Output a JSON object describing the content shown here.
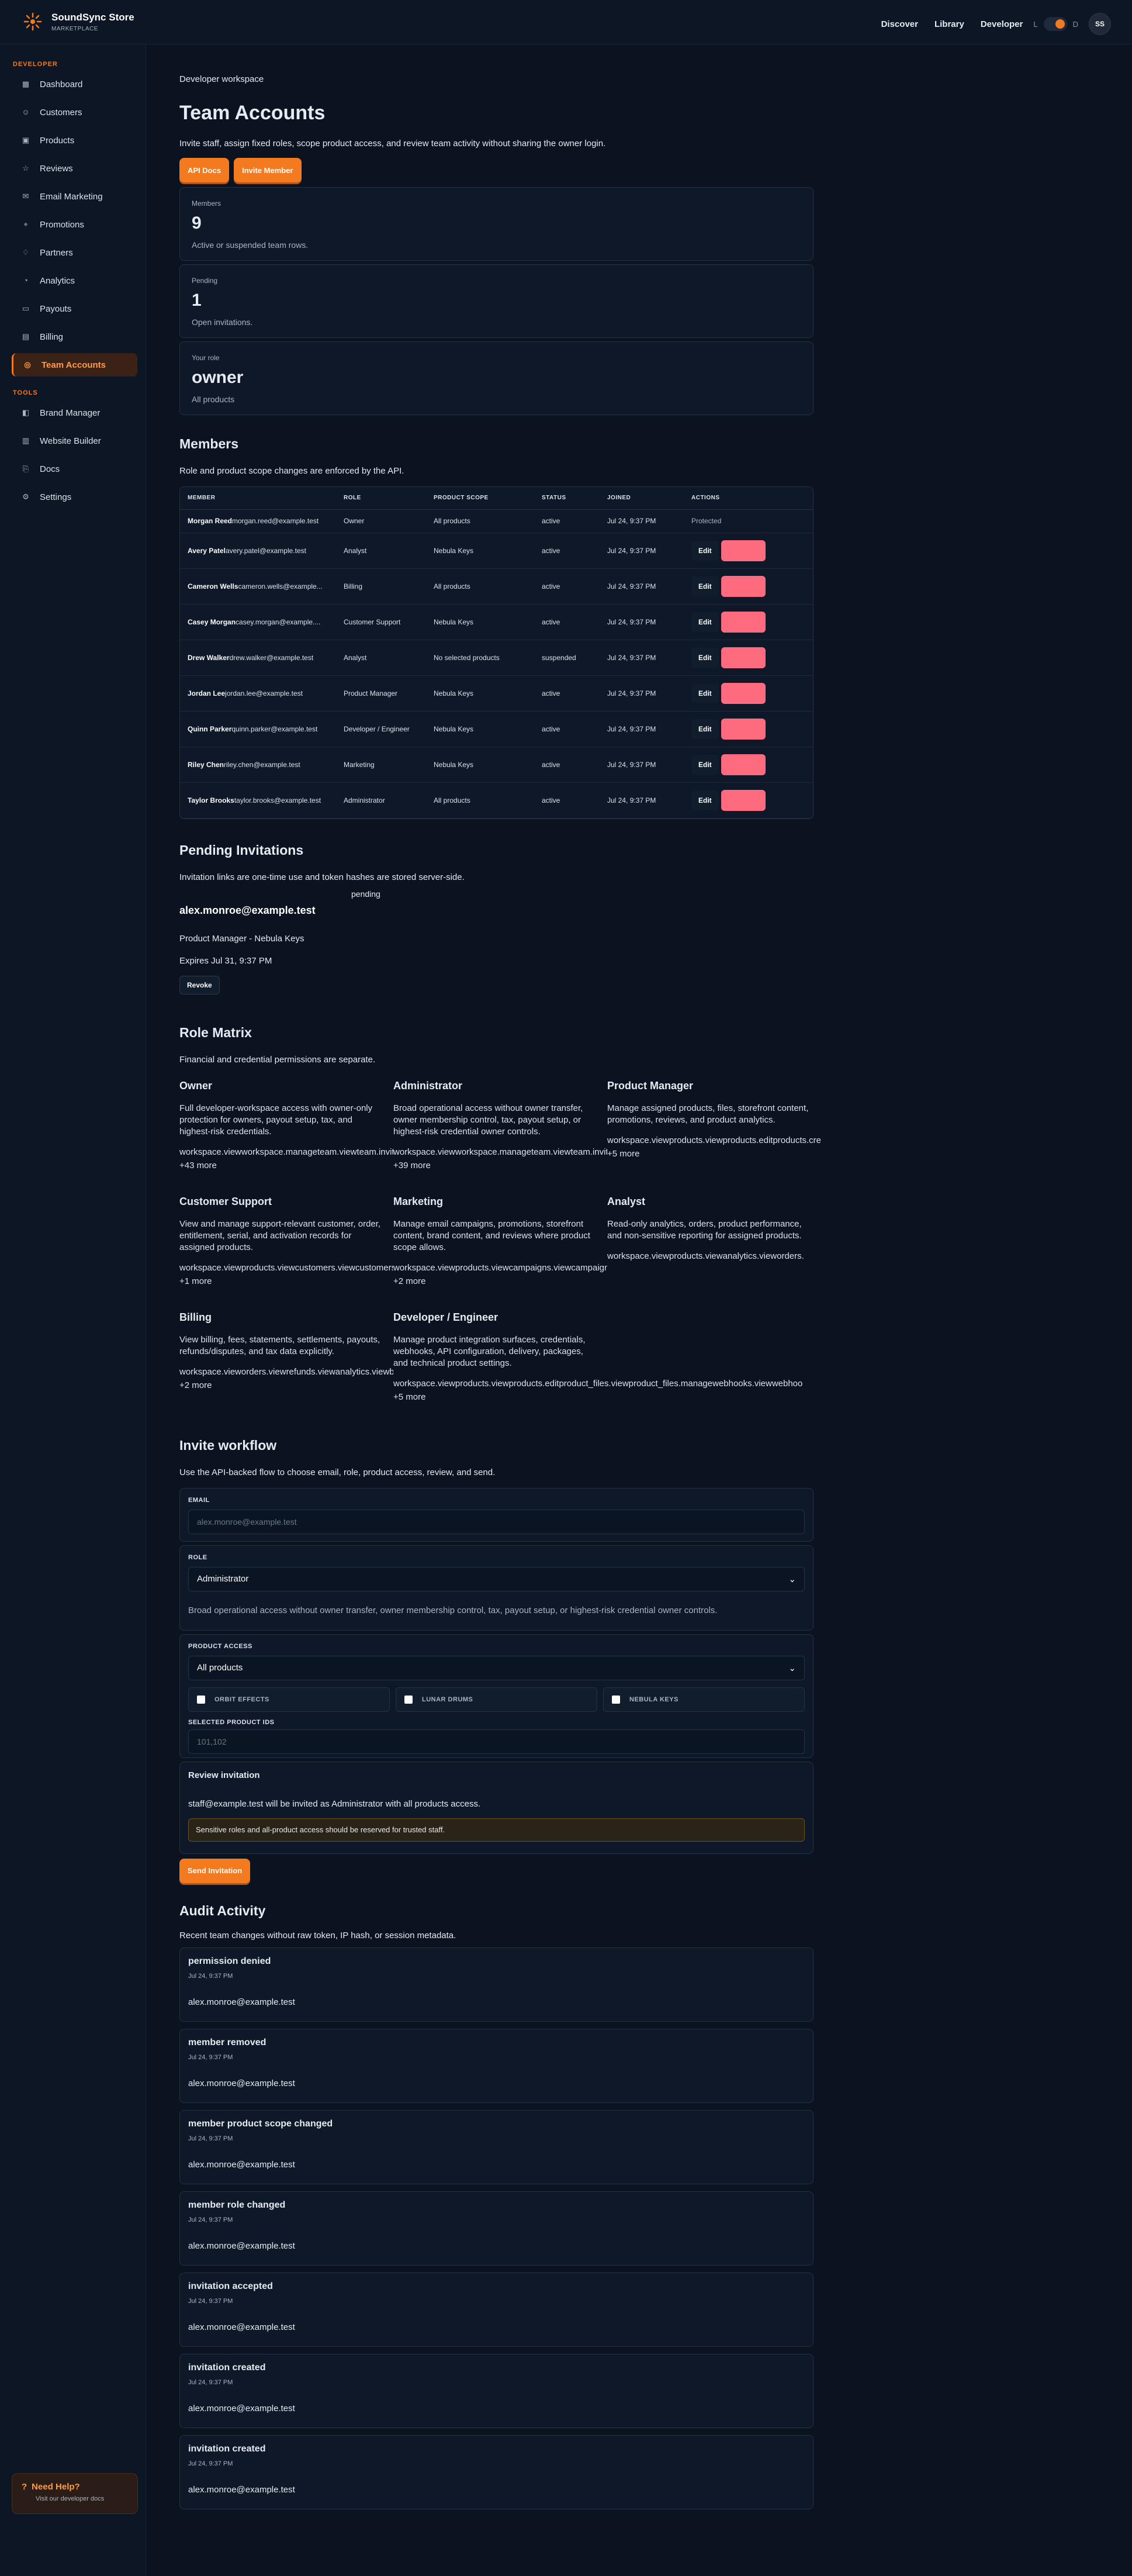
{
  "app": {
    "name": "SoundSync Store",
    "subtitle": "MARKETPLACE"
  },
  "topnav": {
    "discover": "Discover",
    "library": "Library",
    "developer": "Developer",
    "theme_light": "L",
    "theme_dark": "D",
    "avatar": "SS"
  },
  "sidebar": {
    "developer_section": "DEVELOPER",
    "items": [
      {
        "label": "Dashboard",
        "icon": "dashboard-icon"
      },
      {
        "label": "Customers",
        "icon": "users-icon"
      },
      {
        "label": "Products",
        "icon": "box-icon"
      },
      {
        "label": "Reviews",
        "icon": "star-icon"
      },
      {
        "label": "Email Marketing",
        "icon": "mail-icon"
      },
      {
        "label": "Promotions",
        "icon": "tag-icon"
      },
      {
        "label": "Partners",
        "icon": "partners-icon"
      },
      {
        "label": "Analytics",
        "icon": "chart-icon"
      },
      {
        "label": "Payouts",
        "icon": "wallet-icon"
      },
      {
        "label": "Billing",
        "icon": "receipt-icon"
      },
      {
        "label": "Team Accounts",
        "icon": "team-icon"
      }
    ],
    "tools_section": "TOOLS",
    "tools": [
      {
        "label": "Brand Manager",
        "icon": "brand-icon"
      },
      {
        "label": "Website Builder",
        "icon": "web-icon"
      },
      {
        "label": "Docs",
        "icon": "docs-icon"
      },
      {
        "label": "Settings",
        "icon": "gear-icon"
      }
    ],
    "help": {
      "title": "Need Help?",
      "desc": "Visit our developer docs"
    }
  },
  "page": {
    "eyebrow": "Developer workspace",
    "title": "Team Accounts",
    "lead": "Invite staff, assign fixed roles, scope product access, and review team activity without sharing the owner login.",
    "api_docs": "API Docs",
    "invite_member": "Invite Member"
  },
  "stats": [
    {
      "label": "Members",
      "value": "9",
      "desc": "Active or suspended team rows."
    },
    {
      "label": "Pending",
      "value": "1",
      "desc": "Open invitations."
    },
    {
      "label": "Your role",
      "value": "owner",
      "desc": "All products"
    }
  ],
  "members": {
    "title": "Members",
    "sub": "Role and product scope changes are enforced by the API.",
    "headers": [
      "MEMBER",
      "ROLE",
      "PRODUCT SCOPE",
      "STATUS",
      "JOINED",
      "ACTIONS"
    ],
    "edit_label": "Edit",
    "protected_label": "Protected",
    "rows": [
      {
        "name": "Morgan Reed",
        "email": "morgan.reed@example.test",
        "role": "Owner",
        "scope": "All products",
        "status": "active",
        "joined": "Jul 24, 9:37 PM"
      },
      {
        "name": "Avery Patel",
        "email": "avery.patel@example.test",
        "role": "Analyst",
        "scope": "Nebula Keys",
        "status": "active",
        "joined": "Jul 24, 9:37 PM"
      },
      {
        "name": "Cameron Wells",
        "email": "cameron.wells@example...",
        "role": "Billing",
        "scope": "All products",
        "status": "active",
        "joined": "Jul 24, 9:37 PM"
      },
      {
        "name": "Casey Morgan",
        "email": "casey.morgan@example....",
        "role": "Customer Support",
        "scope": "Nebula Keys",
        "status": "active",
        "joined": "Jul 24, 9:37 PM"
      },
      {
        "name": "Drew Walker",
        "email": "drew.walker@example.test",
        "role": "Analyst",
        "scope": "No selected products",
        "status": "suspended",
        "joined": "Jul 24, 9:37 PM"
      },
      {
        "name": "Jordan Lee",
        "email": "jordan.lee@example.test",
        "role": "Product Manager",
        "scope": "Nebula Keys",
        "status": "active",
        "joined": "Jul 24, 9:37 PM"
      },
      {
        "name": "Quinn Parker",
        "email": "quinn.parker@example.test",
        "role": "Developer / Engineer",
        "scope": "Nebula Keys",
        "status": "active",
        "joined": "Jul 24, 9:37 PM"
      },
      {
        "name": "Riley Chen",
        "email": "riley.chen@example.test",
        "role": "Marketing",
        "scope": "Nebula Keys",
        "status": "active",
        "joined": "Jul 24, 9:37 PM"
      },
      {
        "name": "Taylor Brooks",
        "email": "taylor.brooks@example.test",
        "role": "Administrator",
        "scope": "All products",
        "status": "active",
        "joined": "Jul 24, 9:37 PM"
      }
    ]
  },
  "pending": {
    "title": "Pending Invitations",
    "sub": "Invitation links are one-time use and token hashes are stored server-side.",
    "email": "alex.monroe@example.test",
    "status": "pending",
    "role_scope": "Product Manager - Nebula Keys",
    "expires": "Expires Jul 31, 9:37 PM",
    "revoke": "Revoke"
  },
  "matrix": {
    "title": "Role Matrix",
    "sub": "Financial and credential permissions are separate.",
    "roles": [
      {
        "name": "Owner",
        "desc": "Full developer-workspace access with owner-only protection for owners, payout setup, tax, and highest-risk credentials.",
        "perms": "workspace.viewworkspace.manageteam.viewteam.inviteteam.manage",
        "more": "+43 more"
      },
      {
        "name": "Administrator",
        "desc": "Broad operational access without owner transfer, owner membership control, tax, payout setup, or highest-risk credential owner controls.",
        "perms": "workspace.viewworkspace.manageteam.viewteam.inviteteam.manage",
        "more": "+39 more"
      },
      {
        "name": "Product Manager",
        "desc": "Manage assigned products, files, storefront content, promotions, reviews, and product analytics.",
        "perms": "workspace.viewproducts.viewproducts.editproducts.createproduct_files.view",
        "more": "+5 more"
      },
      {
        "name": "Customer Support",
        "desc": "View and manage support-relevant customer, order, entitlement, serial, and activation records for assigned products.",
        "perms": "workspace.viewproducts.viewcustomers.viewcustomers.manageorders.view",
        "more": "+1 more"
      },
      {
        "name": "Marketing",
        "desc": "Manage email campaigns, promotions, storefront content, brand content, and reviews where product scope allows.",
        "perms": "workspace.viewproducts.viewcampaigns.viewcampaigns.managepromotions.view",
        "more": "+2 more"
      },
      {
        "name": "Analyst",
        "desc": "Read-only analytics, orders, product performance, and non-sensitive reporting for assigned products.",
        "perms": "workspace.viewproducts.viewanalytics.vieworders.viewcustomers.view",
        "more": ""
      },
      {
        "name": "Billing",
        "desc": "View billing, fees, statements, settlements, payouts, refunds/disputes, and tax data explicitly.",
        "perms": "workspace.vieworders.viewrefunds.viewanalytics.viewbilling.viewbilling.managestatements.viewsettlements.view",
        "more": "+2 more"
      },
      {
        "name": "Developer / Engineer",
        "desc": "Manage product integration surfaces, credentials, webhooks, API configuration, delivery, packages, and technical product settings.",
        "perms": "workspace.viewproducts.viewproducts.editproduct_files.viewproduct_files.managewebhooks.viewwebhooks.manage",
        "more": "+5 more"
      }
    ]
  },
  "invite": {
    "title": "Invite workflow",
    "sub": "Use the API-backed flow to choose email, role, product access, review, and send.",
    "email_label": "EMAIL",
    "email_placeholder": "alex.monroe@example.test",
    "role_label": "ROLE",
    "role_value": "Administrator",
    "role_desc": "Broad operational access without owner transfer, owner membership control, tax, payout setup, or highest-risk credential owner controls.",
    "access_label": "PRODUCT ACCESS",
    "access_value": "All products",
    "products": [
      "ORBIT EFFECTS",
      "LUNAR DRUMS",
      "NEBULA KEYS"
    ],
    "ids_label": "SELECTED PRODUCT IDS",
    "ids_placeholder": "101,102",
    "review_title": "Review invitation",
    "review_text": "staff@example.test will be invited as Administrator with all products access.",
    "warning": "Sensitive roles and all-product access should be reserved for trusted staff.",
    "send": "Send Invitation"
  },
  "audit": {
    "title": "Audit Activity",
    "sub": "Recent team changes without raw token, IP hash, or session metadata.",
    "events": [
      {
        "title": "permission denied",
        "date": "Jul 24, 9:37 PM",
        "actor": "alex.monroe@example.test"
      },
      {
        "title": "member removed",
        "date": "Jul 24, 9:37 PM",
        "actor": "alex.monroe@example.test"
      },
      {
        "title": "member product scope changed",
        "date": "Jul 24, 9:37 PM",
        "actor": "alex.monroe@example.test"
      },
      {
        "title": "member role changed",
        "date": "Jul 24, 9:37 PM",
        "actor": "alex.monroe@example.test"
      },
      {
        "title": "invitation accepted",
        "date": "Jul 24, 9:37 PM",
        "actor": "alex.monroe@example.test"
      },
      {
        "title": "invitation created",
        "date": "Jul 24, 9:37 PM",
        "actor": "alex.monroe@example.test"
      },
      {
        "title": "invitation created",
        "date": "Jul 24, 9:37 PM",
        "actor": "alex.monroe@example.test"
      }
    ]
  },
  "colors": {
    "accent": "#f47a20",
    "background": "#0b1320",
    "danger": "#ff6b7e"
  }
}
